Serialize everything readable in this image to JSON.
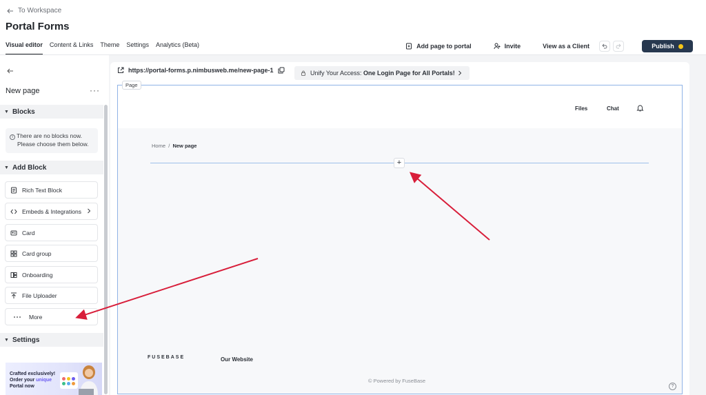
{
  "header": {
    "back_label": "To Workspace",
    "title": "Portal Forms",
    "tabs": [
      {
        "label": "Visual editor",
        "active": true
      },
      {
        "label": "Content & Links"
      },
      {
        "label": "Theme"
      },
      {
        "label": "Settings"
      },
      {
        "label": "Analytics (Beta)"
      }
    ],
    "actions": {
      "add_page": "Add page to portal",
      "invite": "Invite",
      "view_as_client": "View as a Client",
      "publish": "Publish"
    }
  },
  "sidebar": {
    "page_title": "New page",
    "more_menu": "···",
    "blocks_section": "Blocks",
    "empty_line1": "There are no blocks now.",
    "empty_line2": "Please choose them below.",
    "add_block_section": "Add Block",
    "block_items": [
      {
        "label": "Rich Text Block",
        "icon": "document-icon"
      },
      {
        "label": "Embeds & Integrations",
        "icon": "code-icon"
      },
      {
        "label": "Card",
        "icon": "card-icon"
      },
      {
        "label": "Card group",
        "icon": "grid-icon"
      },
      {
        "label": "Onboarding",
        "icon": "onboarding-icon"
      },
      {
        "label": "File Uploader",
        "icon": "upload-icon"
      },
      {
        "label": "More",
        "icon": "more-icon"
      }
    ],
    "settings_section": "Settings",
    "promo": {
      "line1": "Crafted exclusively!",
      "line2_pre": "Order your ",
      "line2_hl": "unique",
      "line3": "Portal now"
    }
  },
  "canvas": {
    "url": "https://portal-forms.p.nimbusweb.me/new-page-1",
    "unify_pre": "Unify Your Access: ",
    "unify_bold": "One Login Page for All Portals!",
    "page_tag": "Page",
    "site_nav": {
      "files": "Files",
      "chat": "Chat"
    },
    "breadcrumb": {
      "home": "Home",
      "sep": "/",
      "current": "New page"
    },
    "insert_symbol": "+",
    "footer": {
      "logo": "FUSEBASE",
      "our_website": "Our Website",
      "powered": "© Powered by FuseBase",
      "help": "?"
    }
  },
  "colors": {
    "publish_bg": "#27384f",
    "publish_dot": "#f5c518",
    "frame_border": "#8fb3e6",
    "annotation_arrow": "#d81e3a"
  }
}
